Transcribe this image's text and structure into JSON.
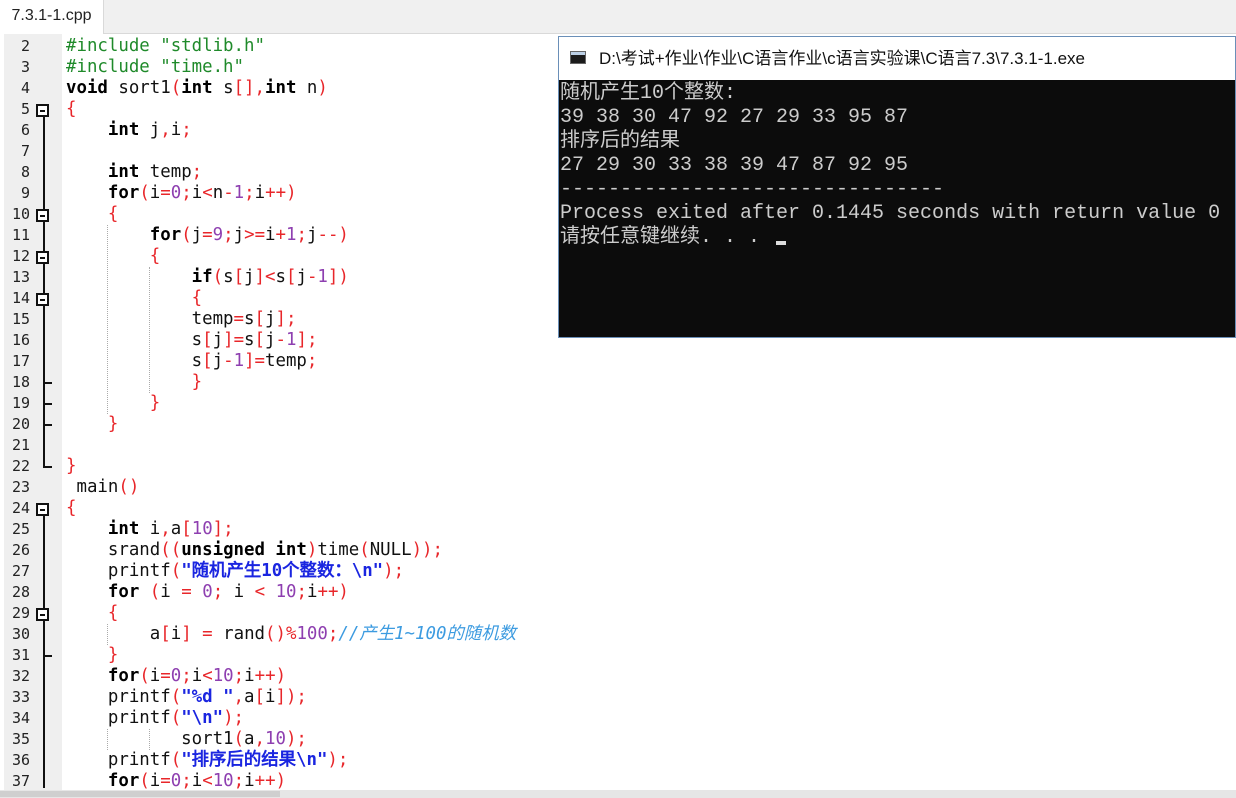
{
  "tab": {
    "label": "7.3.1-1.cpp"
  },
  "colors": {
    "keyword": "#000000",
    "punct": "#e8262a",
    "number": "#8e3fb0",
    "string": "#1a25e0",
    "preprocessor": "#1f8a2a",
    "comment": "#3c9be0"
  },
  "code_lines": [
    {
      "n": "2",
      "tokens": [
        [
          "pp",
          "#include \"stdlib.h\""
        ]
      ]
    },
    {
      "n": "3",
      "tokens": [
        [
          "pp",
          "#include \"time.h\""
        ]
      ]
    },
    {
      "n": "4",
      "tokens": [
        [
          "k",
          "void"
        ],
        [
          "t",
          " sort1"
        ],
        [
          "p",
          "("
        ],
        [
          "k",
          "int"
        ],
        [
          "t",
          " s"
        ],
        [
          "p",
          "[],"
        ],
        [
          "k",
          "int"
        ],
        [
          "t",
          " n"
        ],
        [
          "p",
          ")"
        ]
      ]
    },
    {
      "n": "5",
      "tokens": [
        [
          "p",
          "{"
        ]
      ]
    },
    {
      "n": "6",
      "tokens": [
        [
          "t",
          "    "
        ],
        [
          "k",
          "int"
        ],
        [
          "t",
          " j"
        ],
        [
          "p",
          ","
        ],
        [
          "t",
          "i"
        ],
        [
          "p",
          ";"
        ]
      ]
    },
    {
      "n": "7",
      "tokens": []
    },
    {
      "n": "8",
      "tokens": [
        [
          "t",
          "    "
        ],
        [
          "k",
          "int"
        ],
        [
          "t",
          " temp"
        ],
        [
          "p",
          ";"
        ]
      ]
    },
    {
      "n": "9",
      "tokens": [
        [
          "t",
          "    "
        ],
        [
          "k",
          "for"
        ],
        [
          "p",
          "("
        ],
        [
          "t",
          "i"
        ],
        [
          "p",
          "="
        ],
        [
          "n",
          "0"
        ],
        [
          "p",
          ";"
        ],
        [
          "t",
          "i"
        ],
        [
          "p",
          "<"
        ],
        [
          "t",
          "n"
        ],
        [
          "p",
          "-"
        ],
        [
          "n",
          "1"
        ],
        [
          "p",
          ";"
        ],
        [
          "t",
          "i"
        ],
        [
          "p",
          "++)"
        ]
      ]
    },
    {
      "n": "10",
      "tokens": [
        [
          "t",
          "    "
        ],
        [
          "p",
          "{"
        ]
      ]
    },
    {
      "n": "11",
      "tokens": [
        [
          "t",
          "        "
        ],
        [
          "k",
          "for"
        ],
        [
          "p",
          "("
        ],
        [
          "t",
          "j"
        ],
        [
          "p",
          "="
        ],
        [
          "n",
          "9"
        ],
        [
          "p",
          ";"
        ],
        [
          "t",
          "j"
        ],
        [
          "p",
          ">="
        ],
        [
          "t",
          "i"
        ],
        [
          "p",
          "+"
        ],
        [
          "n",
          "1"
        ],
        [
          "p",
          ";"
        ],
        [
          "t",
          "j"
        ],
        [
          "p",
          "--)"
        ]
      ]
    },
    {
      "n": "12",
      "tokens": [
        [
          "t",
          "        "
        ],
        [
          "p",
          "{"
        ]
      ]
    },
    {
      "n": "13",
      "tokens": [
        [
          "t",
          "            "
        ],
        [
          "k",
          "if"
        ],
        [
          "p",
          "("
        ],
        [
          "t",
          "s"
        ],
        [
          "p",
          "["
        ],
        [
          "t",
          "j"
        ],
        [
          "p",
          "]<"
        ],
        [
          "t",
          "s"
        ],
        [
          "p",
          "["
        ],
        [
          "t",
          "j"
        ],
        [
          "p",
          "-"
        ],
        [
          "n",
          "1"
        ],
        [
          "p",
          "])"
        ]
      ]
    },
    {
      "n": "14",
      "tokens": [
        [
          "t",
          "            "
        ],
        [
          "p",
          "{"
        ]
      ]
    },
    {
      "n": "15",
      "tokens": [
        [
          "t",
          "            temp"
        ],
        [
          "p",
          "="
        ],
        [
          "t",
          "s"
        ],
        [
          "p",
          "["
        ],
        [
          "t",
          "j"
        ],
        [
          "p",
          "];"
        ]
      ]
    },
    {
      "n": "16",
      "tokens": [
        [
          "t",
          "            s"
        ],
        [
          "p",
          "["
        ],
        [
          "t",
          "j"
        ],
        [
          "p",
          "]="
        ],
        [
          "t",
          "s"
        ],
        [
          "p",
          "["
        ],
        [
          "t",
          "j"
        ],
        [
          "p",
          "-"
        ],
        [
          "n",
          "1"
        ],
        [
          "p",
          "];"
        ]
      ]
    },
    {
      "n": "17",
      "tokens": [
        [
          "t",
          "            s"
        ],
        [
          "p",
          "["
        ],
        [
          "t",
          "j"
        ],
        [
          "p",
          "-"
        ],
        [
          "n",
          "1"
        ],
        [
          "p",
          "]="
        ],
        [
          "t",
          "temp"
        ],
        [
          "p",
          ";"
        ]
      ]
    },
    {
      "n": "18",
      "tokens": [
        [
          "t",
          "            "
        ],
        [
          "p",
          "}"
        ]
      ]
    },
    {
      "n": "19",
      "tokens": [
        [
          "t",
          "        "
        ],
        [
          "p",
          "}"
        ]
      ]
    },
    {
      "n": "20",
      "tokens": [
        [
          "t",
          "    "
        ],
        [
          "p",
          "}"
        ]
      ]
    },
    {
      "n": "21",
      "tokens": []
    },
    {
      "n": "22",
      "tokens": [
        [
          "p",
          "}"
        ]
      ]
    },
    {
      "n": "23",
      "tokens": [
        [
          "t",
          " main"
        ],
        [
          "p",
          "()"
        ]
      ]
    },
    {
      "n": "24",
      "tokens": [
        [
          "p",
          "{"
        ]
      ]
    },
    {
      "n": "25",
      "tokens": [
        [
          "t",
          "    "
        ],
        [
          "k",
          "int"
        ],
        [
          "t",
          " i"
        ],
        [
          "p",
          ","
        ],
        [
          "t",
          "a"
        ],
        [
          "p",
          "["
        ],
        [
          "n",
          "10"
        ],
        [
          "p",
          "];"
        ]
      ]
    },
    {
      "n": "26",
      "tokens": [
        [
          "t",
          "    srand"
        ],
        [
          "p",
          "(("
        ],
        [
          "k",
          "unsigned int"
        ],
        [
          "p",
          ")"
        ],
        [
          "t",
          "time"
        ],
        [
          "p",
          "("
        ],
        [
          "t",
          "NULL"
        ],
        [
          "p",
          "));"
        ]
      ]
    },
    {
      "n": "27",
      "tokens": [
        [
          "t",
          "    printf"
        ],
        [
          "p",
          "("
        ],
        [
          "s",
          "\"随机产生10个整数：\\n\""
        ],
        [
          "p",
          ");"
        ]
      ]
    },
    {
      "n": "28",
      "tokens": [
        [
          "t",
          "    "
        ],
        [
          "k",
          "for"
        ],
        [
          "t",
          " "
        ],
        [
          "p",
          "("
        ],
        [
          "t",
          "i "
        ],
        [
          "p",
          "="
        ],
        [
          "t",
          " "
        ],
        [
          "n",
          "0"
        ],
        [
          "p",
          ";"
        ],
        [
          "t",
          " i "
        ],
        [
          "p",
          "<"
        ],
        [
          "t",
          " "
        ],
        [
          "n",
          "10"
        ],
        [
          "p",
          ";"
        ],
        [
          "t",
          "i"
        ],
        [
          "p",
          "++)"
        ]
      ]
    },
    {
      "n": "29",
      "tokens": [
        [
          "t",
          "    "
        ],
        [
          "p",
          "{"
        ]
      ]
    },
    {
      "n": "30",
      "tokens": [
        [
          "t",
          "        a"
        ],
        [
          "p",
          "["
        ],
        [
          "t",
          "i"
        ],
        [
          "p",
          "]"
        ],
        [
          "t",
          " "
        ],
        [
          "p",
          "="
        ],
        [
          "t",
          " rand"
        ],
        [
          "p",
          "()%"
        ],
        [
          "n",
          "100"
        ],
        [
          "p",
          ";"
        ],
        [
          "c",
          "//产生1~100的随机数"
        ]
      ]
    },
    {
      "n": "31",
      "tokens": [
        [
          "t",
          "    "
        ],
        [
          "p",
          "}"
        ]
      ]
    },
    {
      "n": "32",
      "tokens": [
        [
          "t",
          "    "
        ],
        [
          "k",
          "for"
        ],
        [
          "p",
          "("
        ],
        [
          "t",
          "i"
        ],
        [
          "p",
          "="
        ],
        [
          "n",
          "0"
        ],
        [
          "p",
          ";"
        ],
        [
          "t",
          "i"
        ],
        [
          "p",
          "<"
        ],
        [
          "n",
          "10"
        ],
        [
          "p",
          ";"
        ],
        [
          "t",
          "i"
        ],
        [
          "p",
          "++)"
        ]
      ]
    },
    {
      "n": "33",
      "tokens": [
        [
          "t",
          "    printf"
        ],
        [
          "p",
          "("
        ],
        [
          "s",
          "\"%d \""
        ],
        [
          "p",
          ","
        ],
        [
          "t",
          "a"
        ],
        [
          "p",
          "["
        ],
        [
          "t",
          "i"
        ],
        [
          "p",
          "]);"
        ]
      ]
    },
    {
      "n": "34",
      "tokens": [
        [
          "t",
          "    printf"
        ],
        [
          "p",
          "("
        ],
        [
          "s",
          "\"\\n\""
        ],
        [
          "p",
          ");"
        ]
      ]
    },
    {
      "n": "35",
      "tokens": [
        [
          "t",
          "           sort1"
        ],
        [
          "p",
          "("
        ],
        [
          "t",
          "a"
        ],
        [
          "p",
          ","
        ],
        [
          "n",
          "10"
        ],
        [
          "p",
          ");"
        ]
      ]
    },
    {
      "n": "36",
      "tokens": [
        [
          "t",
          "    printf"
        ],
        [
          "p",
          "("
        ],
        [
          "s",
          "\"排序后的结果\\n\""
        ],
        [
          "p",
          ");"
        ]
      ]
    },
    {
      "n": "37",
      "tokens": [
        [
          "t",
          "    "
        ],
        [
          "k",
          "for"
        ],
        [
          "p",
          "("
        ],
        [
          "t",
          "i"
        ],
        [
          "p",
          "="
        ],
        [
          "n",
          "0"
        ],
        [
          "p",
          ";"
        ],
        [
          "t",
          "i"
        ],
        [
          "p",
          "<"
        ],
        [
          "n",
          "10"
        ],
        [
          "p",
          ";"
        ],
        [
          "t",
          "i"
        ],
        [
          "p",
          "++)"
        ]
      ]
    }
  ],
  "console": {
    "title": "D:\\考试+作业\\作业\\C语言作业\\c语言实验课\\C语言7.3\\7.3.1-1.exe",
    "lines": [
      "随机产生10个整数:",
      "39 38 30 47 92 27 29 33 95 87",
      "排序后的结果",
      "27 29 30 33 38 39 47 87 92 95",
      "--------------------------------",
      "Process exited after 0.1445 seconds with return value 0",
      "请按任意键继续. . . "
    ]
  }
}
